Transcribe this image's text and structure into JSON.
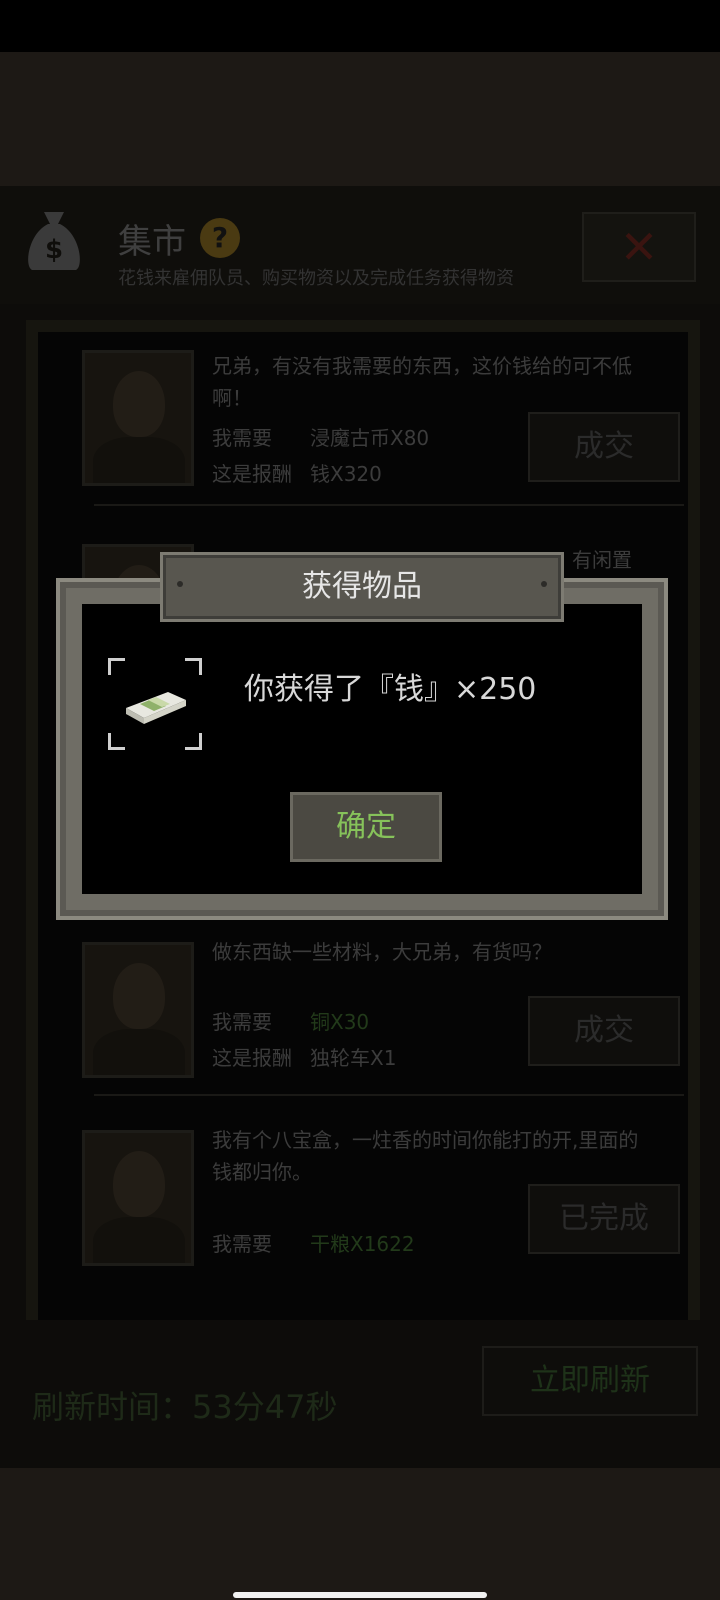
{
  "market": {
    "title": "集市",
    "subtitle": "花钱来雇佣队员、购买物资以及完成任务获得物资",
    "close_label": "✕"
  },
  "offers": [
    {
      "text": "兄弟，有没有我需要的东西，这价钱给的可不低啊！",
      "need_label": "我需要",
      "need_value": "浸魔古币X80",
      "reward_label": "这是报酬",
      "reward_value": "钱X320",
      "button": "成交"
    },
    {
      "text": "做东西缺一些材料，大兄弟，有货吗？",
      "need_label": "我需要",
      "need_value": "铜X30",
      "reward_label": "这是报酬",
      "reward_value": "独轮车X1",
      "button": "成交"
    },
    {
      "text": "我有个八宝盒，一炷香的时间你能打的开,里面的钱都归你。",
      "need_label": "我需要",
      "need_value": "干粮X1622",
      "button": "已完成"
    }
  ],
  "hidden_offer_fragment": "有闲置",
  "refresh": {
    "label": "刷新时间：",
    "time": "53分47秒",
    "button": "立即刷新"
  },
  "modal": {
    "title": "获得物品",
    "message": "你获得了『钱』×250",
    "item_icon": "money-stack-icon",
    "confirm": "确定"
  },
  "colors": {
    "confirm_text": "#86c25a",
    "need_value_green": "#223a1a"
  }
}
